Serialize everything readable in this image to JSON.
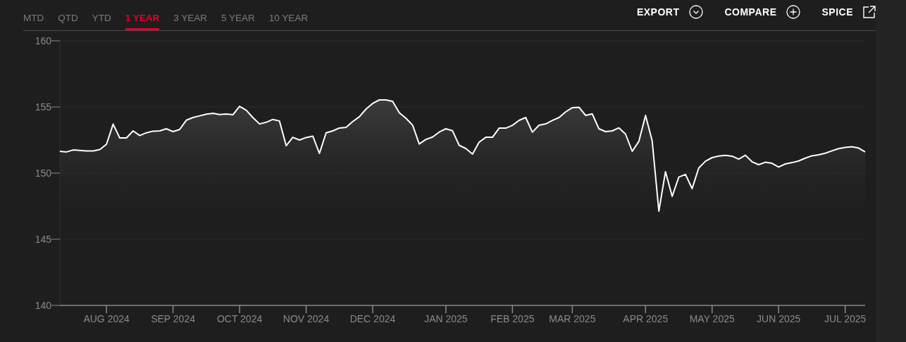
{
  "tabs": [
    {
      "label": "MTD",
      "selected": false
    },
    {
      "label": "QTD",
      "selected": false
    },
    {
      "label": "YTD",
      "selected": false
    },
    {
      "label": "1 YEAR",
      "selected": true
    },
    {
      "label": "3 YEAR",
      "selected": false
    },
    {
      "label": "5 YEAR",
      "selected": false
    },
    {
      "label": "10 YEAR",
      "selected": false
    }
  ],
  "actions": [
    {
      "label": "EXPORT",
      "kind": "export"
    },
    {
      "label": "COMPARE",
      "kind": "compare"
    },
    {
      "label": "SPICE",
      "kind": "external"
    }
  ],
  "chart_data": {
    "type": "area",
    "grid": true,
    "ylim": [
      140,
      160
    ],
    "yticks": [
      140,
      145,
      150,
      155,
      160
    ],
    "categories": [
      null,
      null,
      null,
      null,
      null,
      null,
      null,
      "AUG 2024",
      null,
      null,
      null,
      null,
      null,
      null,
      null,
      null,
      null,
      "SEP 2024",
      null,
      null,
      null,
      null,
      null,
      null,
      null,
      null,
      null,
      "OCT 2024",
      null,
      null,
      null,
      null,
      null,
      null,
      null,
      null,
      null,
      "NOV 2024",
      null,
      null,
      null,
      null,
      null,
      null,
      null,
      null,
      null,
      "DEC 2024",
      null,
      null,
      null,
      null,
      null,
      null,
      null,
      null,
      null,
      null,
      "JAN 2025",
      null,
      null,
      null,
      null,
      null,
      null,
      null,
      null,
      null,
      "FEB 2025",
      null,
      null,
      null,
      null,
      null,
      null,
      null,
      null,
      "MAR 2025",
      null,
      null,
      null,
      null,
      null,
      null,
      null,
      null,
      null,
      null,
      "APR 2025",
      null,
      null,
      null,
      null,
      null,
      null,
      null,
      null,
      null,
      "MAY 2025",
      null,
      null,
      null,
      null,
      null,
      null,
      null,
      null,
      null,
      "JUN 2025",
      null,
      null,
      null,
      null,
      null,
      null,
      null,
      null,
      null,
      "JUL 2025",
      null,
      null,
      null
    ],
    "series": [
      {
        "color": "#ffffff",
        "values": [
          151.65,
          151.6,
          151.75,
          151.72,
          151.68,
          151.68,
          151.78,
          152.18,
          153.7,
          152.66,
          152.66,
          153.19,
          152.84,
          153.05,
          153.17,
          153.19,
          153.35,
          153.14,
          153.3,
          154.0,
          154.2,
          154.33,
          154.46,
          154.52,
          154.43,
          154.47,
          154.41,
          155.05,
          154.75,
          154.2,
          153.72,
          153.84,
          154.06,
          153.94,
          152.07,
          152.71,
          152.5,
          152.69,
          152.8,
          151.49,
          153.05,
          153.19,
          153.41,
          153.46,
          153.9,
          154.26,
          154.84,
          155.27,
          155.53,
          155.53,
          155.42,
          154.56,
          154.15,
          153.62,
          152.2,
          152.55,
          152.73,
          153.1,
          153.35,
          153.2,
          152.1,
          151.86,
          151.44,
          152.34,
          152.71,
          152.71,
          153.4,
          153.4,
          153.61,
          153.99,
          154.2,
          153.09,
          153.62,
          153.72,
          153.98,
          154.2,
          154.63,
          154.95,
          154.98,
          154.36,
          154.48,
          153.35,
          153.14,
          153.19,
          153.42,
          152.95,
          151.65,
          152.4,
          154.36,
          152.45,
          147.13,
          150.11,
          148.24,
          149.7,
          149.9,
          148.83,
          150.39,
          150.9,
          151.17,
          151.29,
          151.34,
          151.28,
          151.06,
          151.35,
          150.86,
          150.64,
          150.82,
          150.74,
          150.46,
          150.69,
          150.79,
          150.92,
          151.13,
          151.31,
          151.39,
          151.5,
          151.68,
          151.85,
          151.94,
          151.99,
          151.9,
          151.6
        ]
      }
    ]
  }
}
